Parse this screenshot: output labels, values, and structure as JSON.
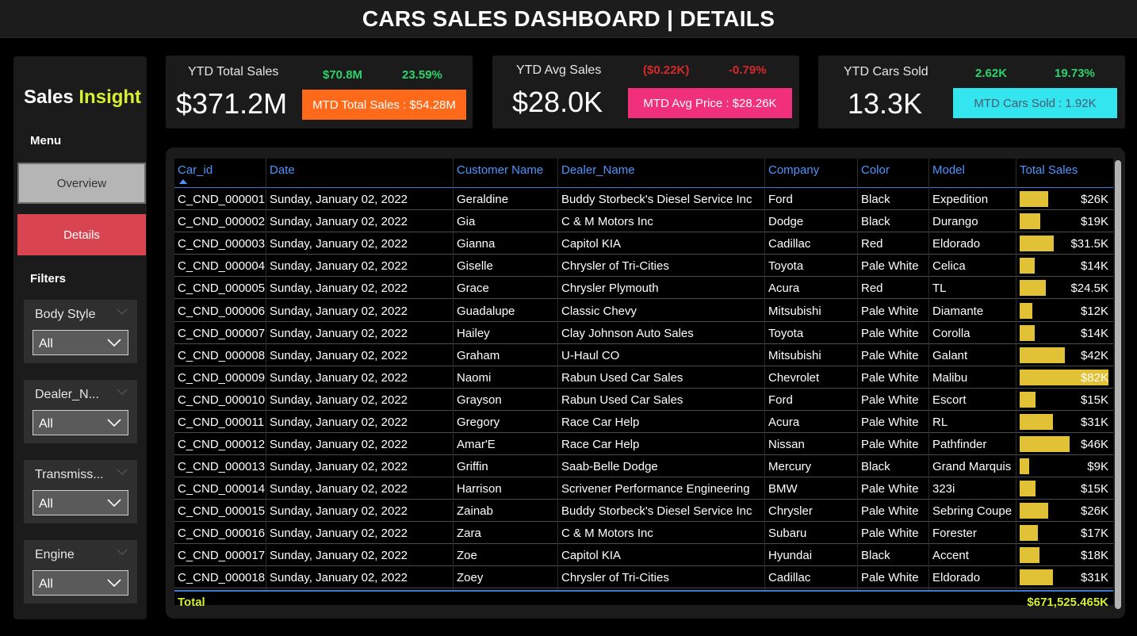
{
  "header": {
    "title": "CARS SALES DASHBOARD | DETAILS"
  },
  "sidebar": {
    "brand_part1": "Sales",
    "brand_part2": "Insight",
    "menu_label": "Menu",
    "nav": {
      "overview": "Overview",
      "details": "Details"
    },
    "filters_label": "Filters",
    "slicers": [
      {
        "title": "Body Style",
        "value": "All"
      },
      {
        "title": "Dealer_N...",
        "value": "All"
      },
      {
        "title": "Transmiss...",
        "value": "All"
      },
      {
        "title": "Engine",
        "value": "All"
      }
    ]
  },
  "kpis": [
    {
      "title": "YTD Total Sales",
      "value": "$371.2M",
      "delta_value": "$70.8M",
      "delta_pct": "23.59%",
      "delta_color": "#2bd46b",
      "badge": "MTD Total Sales : $54.28M",
      "badge_bg": "#ff6a1a",
      "badge_fg": "#ffffff"
    },
    {
      "title": "YTD Avg Sales",
      "value": "$28.0K",
      "delta_value": "($0.22K)",
      "delta_pct": "-0.79%",
      "delta_color": "#d52a2a",
      "badge": "MTD Avg Price : $28.26K",
      "badge_bg": "#f0307a",
      "badge_fg": "#ffffff"
    },
    {
      "title": "YTD Cars Sold",
      "value": "13.3K",
      "delta_value": "2.62K",
      "delta_pct": "19.73%",
      "delta_color": "#2bd46b",
      "badge": "MTD Cars Sold : 1.92K",
      "badge_bg": "#33e5ef",
      "badge_fg": "#4b5a73"
    }
  ],
  "table": {
    "columns": [
      "Car_id",
      "Date",
      "Customer Name",
      "Dealer_Name",
      "Company",
      "Color",
      "Model",
      "Total Sales"
    ],
    "rows": [
      {
        "id": "C_CND_000001",
        "date": "Sunday, January 02, 2022",
        "customer": "Geraldine",
        "dealer": "Buddy Storbeck's Diesel Service Inc",
        "company": "Ford",
        "color": "Black",
        "model": "Expedition",
        "sales": "$26K",
        "value": 26
      },
      {
        "id": "C_CND_000002",
        "date": "Sunday, January 02, 2022",
        "customer": "Gia",
        "dealer": "C & M Motors Inc",
        "company": "Dodge",
        "color": "Black",
        "model": "Durango",
        "sales": "$19K",
        "value": 19
      },
      {
        "id": "C_CND_000003",
        "date": "Sunday, January 02, 2022",
        "customer": "Gianna",
        "dealer": "Capitol KIA",
        "company": "Cadillac",
        "color": "Red",
        "model": "Eldorado",
        "sales": "$31.5K",
        "value": 31.5
      },
      {
        "id": "C_CND_000004",
        "date": "Sunday, January 02, 2022",
        "customer": "Giselle",
        "dealer": "Chrysler of Tri-Cities",
        "company": "Toyota",
        "color": "Pale White",
        "model": "Celica",
        "sales": "$14K",
        "value": 14
      },
      {
        "id": "C_CND_000005",
        "date": "Sunday, January 02, 2022",
        "customer": "Grace",
        "dealer": "Chrysler Plymouth",
        "company": "Acura",
        "color": "Red",
        "model": "TL",
        "sales": "$24.5K",
        "value": 24.5
      },
      {
        "id": "C_CND_000006",
        "date": "Sunday, January 02, 2022",
        "customer": "Guadalupe",
        "dealer": "Classic Chevy",
        "company": "Mitsubishi",
        "color": "Pale White",
        "model": "Diamante",
        "sales": "$12K",
        "value": 12
      },
      {
        "id": "C_CND_000007",
        "date": "Sunday, January 02, 2022",
        "customer": "Hailey",
        "dealer": "Clay Johnson Auto Sales",
        "company": "Toyota",
        "color": "Pale White",
        "model": "Corolla",
        "sales": "$14K",
        "value": 14
      },
      {
        "id": "C_CND_000008",
        "date": "Sunday, January 02, 2022",
        "customer": "Graham",
        "dealer": "U-Haul CO",
        "company": "Mitsubishi",
        "color": "Pale White",
        "model": "Galant",
        "sales": "$42K",
        "value": 42
      },
      {
        "id": "C_CND_000009",
        "date": "Sunday, January 02, 2022",
        "customer": "Naomi",
        "dealer": "Rabun Used Car Sales",
        "company": "Chevrolet",
        "color": "Pale White",
        "model": "Malibu",
        "sales": "$82K",
        "value": 82
      },
      {
        "id": "C_CND_000010",
        "date": "Sunday, January 02, 2022",
        "customer": "Grayson",
        "dealer": "Rabun Used Car Sales",
        "company": "Ford",
        "color": "Pale White",
        "model": "Escort",
        "sales": "$15K",
        "value": 15
      },
      {
        "id": "C_CND_000011",
        "date": "Sunday, January 02, 2022",
        "customer": "Gregory",
        "dealer": "Race Car Help",
        "company": "Acura",
        "color": "Pale White",
        "model": "RL",
        "sales": "$31K",
        "value": 31
      },
      {
        "id": "C_CND_000012",
        "date": "Sunday, January 02, 2022",
        "customer": "Amar'E",
        "dealer": "Race Car Help",
        "company": "Nissan",
        "color": "Pale White",
        "model": "Pathfinder",
        "sales": "$46K",
        "value": 46
      },
      {
        "id": "C_CND_000013",
        "date": "Sunday, January 02, 2022",
        "customer": "Griffin",
        "dealer": "Saab-Belle Dodge",
        "company": "Mercury",
        "color": "Black",
        "model": "Grand Marquis",
        "sales": "$9K",
        "value": 9
      },
      {
        "id": "C_CND_000014",
        "date": "Sunday, January 02, 2022",
        "customer": "Harrison",
        "dealer": "Scrivener Performance Engineering",
        "company": "BMW",
        "color": "Pale White",
        "model": "323i",
        "sales": "$15K",
        "value": 15
      },
      {
        "id": "C_CND_000015",
        "date": "Sunday, January 02, 2022",
        "customer": "Zainab",
        "dealer": "Buddy Storbeck's Diesel Service Inc",
        "company": "Chrysler",
        "color": "Pale White",
        "model": "Sebring Coupe",
        "sales": "$26K",
        "value": 26
      },
      {
        "id": "C_CND_000016",
        "date": "Sunday, January 02, 2022",
        "customer": "Zara",
        "dealer": "C & M Motors Inc",
        "company": "Subaru",
        "color": "Pale White",
        "model": "Forester",
        "sales": "$17K",
        "value": 17
      },
      {
        "id": "C_CND_000017",
        "date": "Sunday, January 02, 2022",
        "customer": "Zoe",
        "dealer": "Capitol KIA",
        "company": "Hyundai",
        "color": "Black",
        "model": "Accent",
        "sales": "$18K",
        "value": 18
      },
      {
        "id": "C_CND_000018",
        "date": "Sunday, January 02, 2022",
        "customer": "Zoey",
        "dealer": "Chrysler of Tri-Cities",
        "company": "Cadillac",
        "color": "Pale White",
        "model": "Eldorado",
        "sales": "$31K",
        "value": 31
      }
    ],
    "total_label": "Total",
    "total_value": "$671,525.465K",
    "bar_max": 82,
    "bar_color": "#e1c236"
  }
}
